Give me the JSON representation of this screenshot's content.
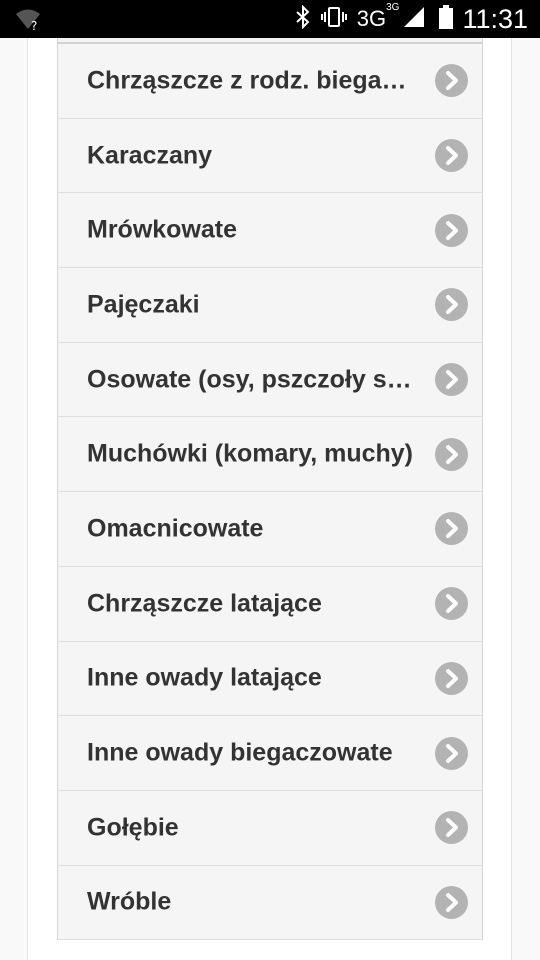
{
  "status_bar": {
    "network": "3G",
    "network_superscript": "3G",
    "time": "11:31"
  },
  "list": {
    "items": [
      {
        "label": "Chrząszcze z rodz. biegaczowatych"
      },
      {
        "label": "Karaczany"
      },
      {
        "label": "Mrówkowate"
      },
      {
        "label": "Pajęczaki"
      },
      {
        "label": "Osowate (osy, pszczoły szerszenie)"
      },
      {
        "label": "Muchówki (komary, muchy)"
      },
      {
        "label": "Omacnicowate"
      },
      {
        "label": "Chrząszcze latające"
      },
      {
        "label": "Inne owady latające"
      },
      {
        "label": "Inne owady biegaczowate"
      },
      {
        "label": "Gołębie"
      },
      {
        "label": "Wróble"
      }
    ]
  },
  "icons": {
    "row_icon": "chevron-right-circle-icon",
    "wifi": "wifi-unknown-icon",
    "bluetooth": "bluetooth-icon",
    "vibrate": "vibrate-icon",
    "signal": "signal-icon",
    "battery": "battery-icon"
  },
  "colors": {
    "status_bar_bg": "#000000",
    "row_bg": "#f5f5f5",
    "row_text": "#333333",
    "chevron_bg": "#b3b3b3",
    "chevron_arrow": "#ffffff"
  }
}
